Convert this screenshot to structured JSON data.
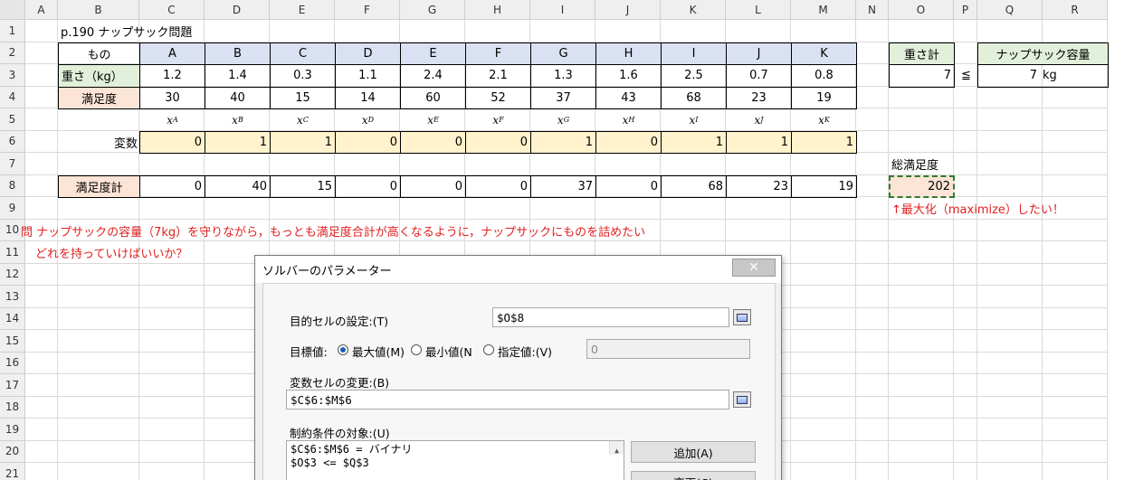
{
  "columns": [
    "A",
    "B",
    "C",
    "D",
    "E",
    "F",
    "G",
    "H",
    "I",
    "J",
    "K",
    "L",
    "M",
    "N",
    "O",
    "P",
    "Q",
    "R"
  ],
  "rows": [
    "1",
    "2",
    "3",
    "4",
    "5",
    "6",
    "7",
    "8",
    "9",
    "10",
    "11",
    "12",
    "13",
    "14",
    "15",
    "16",
    "17",
    "18",
    "19",
    "20",
    "21"
  ],
  "title": "p.190 ナップサック問題",
  "table": {
    "item_label": "もの",
    "weight_label": "重さ（kg）",
    "satisfaction_label": "満足度",
    "var_label": "変数",
    "total_label": "満足度計",
    "items": [
      "A",
      "B",
      "C",
      "D",
      "E",
      "F",
      "G",
      "H",
      "I",
      "J",
      "K"
    ],
    "weights": [
      "1.2",
      "1.4",
      "0.3",
      "1.1",
      "2.4",
      "2.1",
      "1.3",
      "1.6",
      "2.5",
      "0.7",
      "0.8"
    ],
    "satisfaction": [
      "30",
      "40",
      "15",
      "14",
      "60",
      "52",
      "37",
      "43",
      "68",
      "23",
      "19"
    ],
    "var_symbols": [
      "x",
      "x",
      "x",
      "x",
      "x",
      "x",
      "x",
      "x",
      "x",
      "x",
      "x"
    ],
    "var_subs": [
      "A",
      "B",
      "C",
      "D",
      "E",
      "F",
      "G",
      "H",
      "I",
      "J",
      "K"
    ],
    "vars": [
      "0",
      "1",
      "1",
      "0",
      "0",
      "0",
      "1",
      "0",
      "1",
      "1",
      "1"
    ],
    "totals": [
      "0",
      "40",
      "15",
      "0",
      "0",
      "0",
      "37",
      "0",
      "68",
      "23",
      "19"
    ]
  },
  "summary": {
    "weight_total_label": "重さ計",
    "weight_total": "7",
    "leq": "≦",
    "capacity_label": "ナップサック容量",
    "capacity": "7",
    "capacity_unit": "kg",
    "total_satisfaction_label": "総満足度",
    "total_satisfaction": "202",
    "maximize_note": "↑最大化（maximize）したい！"
  },
  "problem": {
    "line1": "問 ナップサックの容量（7kg）を守りながら，もっとも満足度合計が高くなるように，ナップサックにものを詰めたい",
    "line2": "どれを持っていけばいいか？"
  },
  "dialog": {
    "title": "ソルバーのパラメーター",
    "objective_label": "目的セルの設定:(T)",
    "objective_value": "$O$8",
    "target_label": "目標値:",
    "opt_max": "最大値(M)",
    "opt_min": "最小値(N",
    "opt_value": "指定値:(V)",
    "value_of": "0",
    "changing_label": "変数セルの変更:(B)",
    "changing_value": "$C$6:$M$6",
    "constraints_label": "制約条件の対象:(U)",
    "constraints": [
      "$C$6:$M$6 = バイナリ",
      "$O$3 <= $Q$3"
    ],
    "add_button": "追加(A)",
    "change_button": "変更(C)"
  },
  "colors": {
    "header_bg": "#efefef",
    "blue_fill": "#d9e1f2",
    "green_fill": "#e2efda",
    "peach_fill": "#fce4d6",
    "yellow_fill": "#fff2cc",
    "note_red": "#e02020"
  }
}
